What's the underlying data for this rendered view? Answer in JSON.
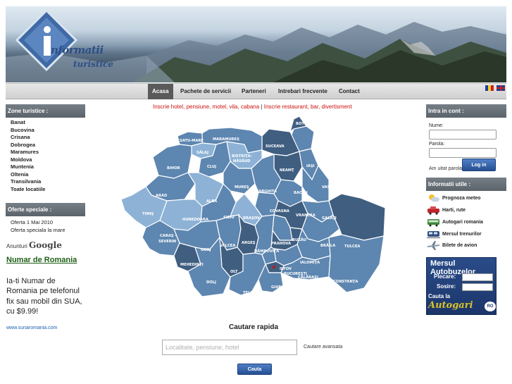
{
  "logo": {
    "line1": "nformatii",
    "line2": "turistice",
    "mark": "i"
  },
  "nav": {
    "items": [
      {
        "label": "Acasa",
        "active": true
      },
      {
        "label": "Pachete de servicii",
        "active": false
      },
      {
        "label": "Parteneri",
        "active": false
      },
      {
        "label": "Intrebari frecvente",
        "active": false
      },
      {
        "label": "Contact",
        "active": false
      }
    ],
    "flags": [
      "romania-flag",
      "uk-flag"
    ]
  },
  "sidebar_left": {
    "zones_title": "Zone turistice :",
    "zones": [
      "Banat",
      "Bucovina",
      "Crisana",
      "Dobrogea",
      "Maramures",
      "Moldova",
      "Muntenia",
      "Oltenia",
      "Transilvania",
      "Toate locatiile"
    ],
    "offers_title": "Oferte speciale :",
    "offers": [
      "Oferta 1 Mai 2010",
      "Oferta speciala la mare"
    ],
    "ads": {
      "label": "Anunturi",
      "brand": "Google",
      "title": "Numar de Romania",
      "body": "Ia-ti Numar de Romania pe telefonul fix sau mobil din SUA, cu $9.99!",
      "url": "www.sunaromania.com"
    }
  },
  "main": {
    "inscrie_hotel": "Inscrie hotel, pensiune, motel, vila, cabana",
    "separator": " | ",
    "inscrie_restaurant": "Inscrie restaurant, bar, divertisment",
    "map_regions": [
      "SATU-MARE",
      "MARAMUREŞ",
      "BOTOŞANI",
      "SUCEAVA",
      "BISTRIŢA-NĂSĂUD",
      "SĂLAJ",
      "BIHOR",
      "CLUJ",
      "NEAMŢ",
      "IAŞI",
      "MUREŞ",
      "HARGHITA",
      "BACĂU",
      "VASLUI",
      "ARAD",
      "ALBA",
      "COVASNA",
      "VRANCEA",
      "GALAŢI",
      "TIMIŞ",
      "HUNEDOARA",
      "SIBIU",
      "BRAŞOV",
      "CARAŞ-SEVERIN",
      "VÂLCEA",
      "ARGEŞ",
      "BUZĂU",
      "BRĂILA",
      "TULCEA",
      "GORJ",
      "DÂMBOVIŢA",
      "PRAHOVA",
      "IALOMIŢA",
      "MEHEDINŢI",
      "OLT",
      "ILFOV",
      "BUCUREŞTI",
      "CĂLĂRAŞI",
      "DOLJ",
      "TELEORMAN",
      "GIURGIU",
      "CONSTANŢA"
    ],
    "search_title": "Cautare rapida",
    "search_placeholder": "Localitate, pensiune, hotel",
    "advanced_search": "Cautare avansata",
    "search_button": "Cauta"
  },
  "sidebar_right": {
    "login_title": "Intra in cont :",
    "username_label": "Nume:",
    "password_label": "Parola:",
    "forgot": "Am uitat parola",
    "login_button": "Log in",
    "utils_title": "Informatii utile :",
    "utils": [
      {
        "label": "Prognoza meteo",
        "icon": "weather-icon"
      },
      {
        "label": "Harti, rute",
        "icon": "car-icon"
      },
      {
        "label": "Autogari romania",
        "icon": "bus-icon"
      },
      {
        "label": "Mersul trenurilor",
        "icon": "train-icon"
      },
      {
        "label": "Bilete de avion",
        "icon": "plane-icon"
      }
    ],
    "bus_box": {
      "title": "Mersul Autobuzelor",
      "from_label": "Plecare:",
      "to_label": "Sosire:",
      "search_label": "Cauta la",
      "brand": "Autogari",
      "brand_suffix": "RO"
    }
  },
  "colors": {
    "map_dark": "#3f5e80",
    "map_mid": "#5d86b0",
    "map_light": "#8db2d6",
    "accent_red": "#cc1111",
    "button_blue": "#274f93"
  }
}
